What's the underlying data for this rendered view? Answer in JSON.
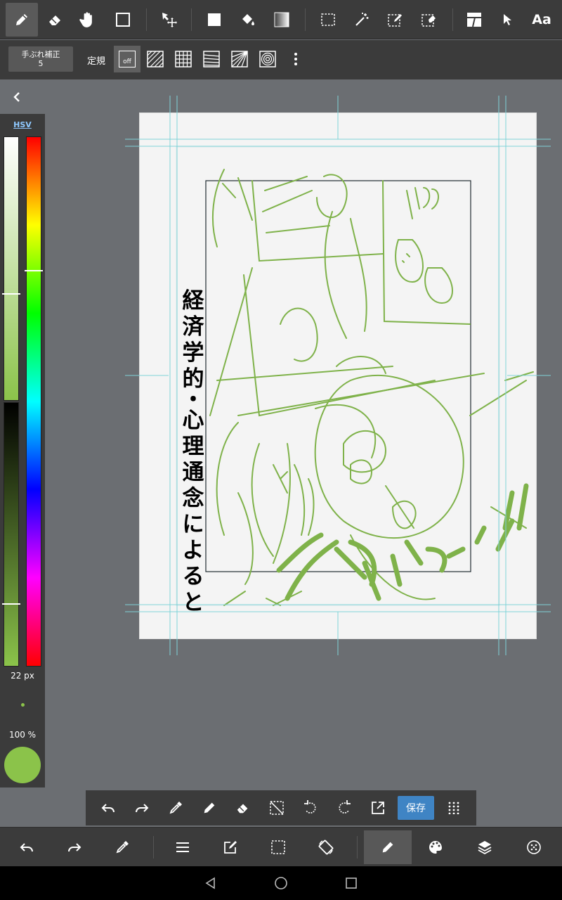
{
  "toolbar": {
    "tools": [
      "pen-tool",
      "eraser-tool",
      "hand-tool",
      "rectangle-tool",
      "move-tool",
      "fill-shape-tool",
      "bucket-fill-tool",
      "gradient-tool",
      "select-rect-tool",
      "magic-wand-tool",
      "select-pen-tool",
      "select-eraser-tool",
      "frame-divider-tool",
      "operation-tool",
      "text-tool"
    ],
    "text_tool_label": "Aa",
    "active_tool": "pen-tool"
  },
  "subbar": {
    "stabilizer_label": "手ぶれ補正",
    "stabilizer_value": "5",
    "ruler_label": "定規",
    "ruler_off_label": "off"
  },
  "color_panel": {
    "mode_label": "HSV",
    "brush_size": "22 px",
    "opacity": "100 %",
    "current_color": "#8bc34a"
  },
  "canvas": {
    "caption_chars": [
      "経",
      "済",
      "学",
      "的",
      "・",
      "心",
      "理",
      "通",
      "念",
      "に",
      "よ",
      "る",
      "と"
    ]
  },
  "quickbar": {
    "save_label": "保存"
  },
  "colors": {
    "ui_bg": "#3b3b3b",
    "accent": "#3f84c4",
    "guide": "#7fd3d8",
    "brush": "#8bc34a"
  }
}
